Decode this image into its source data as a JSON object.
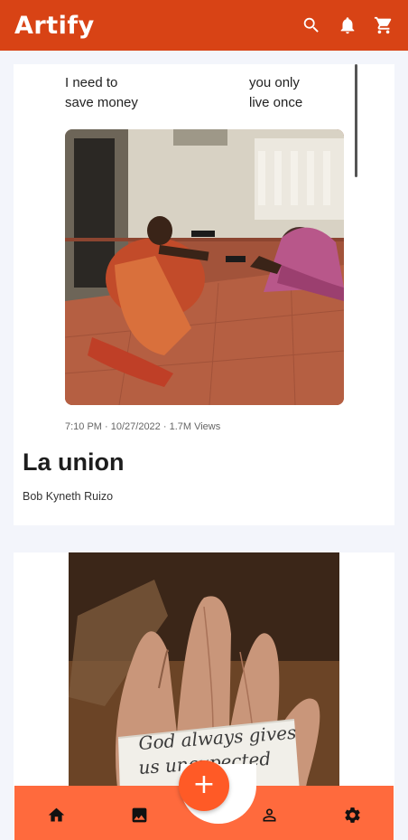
{
  "app": {
    "title": "Artify",
    "brand_color": "#d84315",
    "accent_color": "#ff6a3d"
  },
  "topbar": {
    "icons": [
      "search-icon",
      "bell-icon",
      "cart-icon"
    ]
  },
  "posts": [
    {
      "image_caption_left": "I need to\nsave money",
      "image_caption_right": "you only\nlive once",
      "image_meta": "7:10 PM · 10/27/2022 · 1.7M Views",
      "title": "La union",
      "author": "Bob Kyneth Ruizo"
    },
    {
      "image_note_text": "God always gives\nus unexpected"
    }
  ],
  "bottom_nav": {
    "items": [
      "home-icon",
      "image-icon",
      "person-icon",
      "gear-icon"
    ],
    "fab_label": "+"
  }
}
